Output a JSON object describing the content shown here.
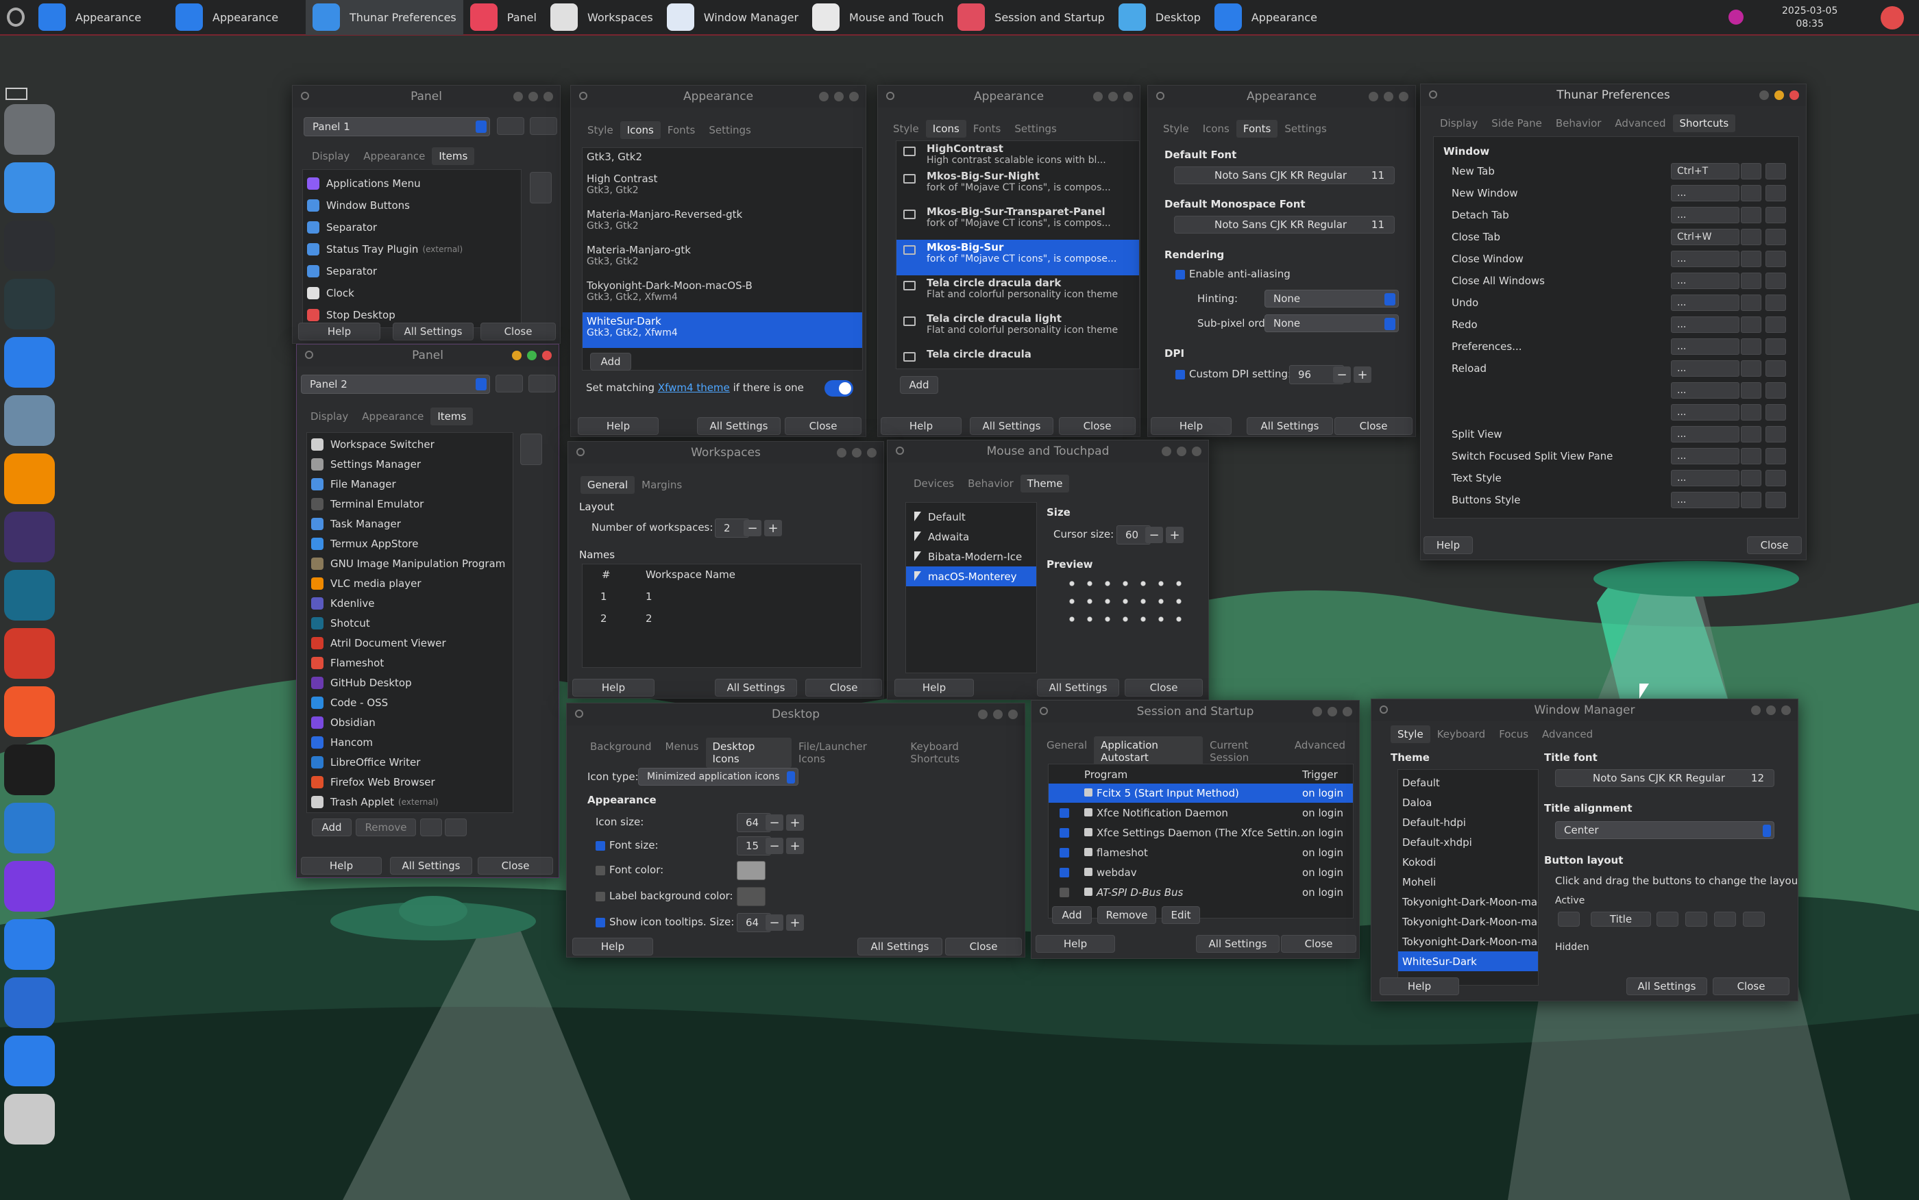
{
  "topbar": {
    "tasks": [
      {
        "label": "Appearance",
        "color": "#2b7de9"
      },
      {
        "label": "Appearance",
        "color": "#2b7de9"
      },
      {
        "label": "Thunar Preferences",
        "color": "#3a8ee6",
        "active": true
      },
      {
        "label": "Panel",
        "color": "#e8445a"
      },
      {
        "label": "Workspaces",
        "color": "#e0e0e0"
      },
      {
        "label": "Window Manager",
        "color": "#dfe8f5"
      },
      {
        "label": "Mouse and Touch",
        "color": "#e8e8e8"
      },
      {
        "label": "Session and Startup",
        "color": "#e04c5e"
      },
      {
        "label": "Desktop",
        "color": "#4aa8e8"
      },
      {
        "label": "Appearance",
        "color": "#2b7de9"
      }
    ],
    "date": "2025-03-05",
    "time": "08:35"
  },
  "dock": {
    "icons": [
      "system-preferences-icon",
      "finder-icon",
      "terminal-icon",
      "activity-monitor-icon",
      "app-store-icon",
      "preview-icon",
      "vlc-icon",
      "kdenlive-icon",
      "shotcut-icon",
      "pdf-viewer-icon",
      "flameshot-icon",
      "github-icon",
      "vscode-icon",
      "obsidian-icon",
      "text-editor-icon",
      "writer-icon",
      "firefox-icon",
      "trash-icon"
    ]
  },
  "panel1": {
    "title": "Panel",
    "selector": "Panel 1",
    "tabs": [
      "Display",
      "Appearance",
      "Items"
    ],
    "items": [
      {
        "label": "Applications Menu",
        "color": "#8c5cf5"
      },
      {
        "label": "Window Buttons",
        "color": "#4a90e2"
      },
      {
        "label": "Separator",
        "color": "#4a90e2"
      },
      {
        "label": "Status Tray Plugin",
        "extra": "(external)",
        "color": "#4a90e2"
      },
      {
        "label": "Separator",
        "color": "#4a90e2"
      },
      {
        "label": "Clock",
        "color": "#e0e0e0"
      },
      {
        "label": "Stop Desktop",
        "color": "#e24b4b"
      }
    ],
    "help": "Help",
    "all": "All Settings",
    "close": "Close"
  },
  "panel2": {
    "title": "Panel",
    "selector": "Panel 2",
    "tabs": [
      "Display",
      "Appearance",
      "Items"
    ],
    "items": [
      {
        "label": "Workspace Switcher",
        "color": "#cfcfcf"
      },
      {
        "label": "Settings Manager",
        "color": "#9a9a9a"
      },
      {
        "label": "File Manager",
        "color": "#4a90e2"
      },
      {
        "label": "Terminal Emulator",
        "color": "#555"
      },
      {
        "label": "Task Manager",
        "color": "#4a90e2"
      },
      {
        "label": "Termux AppStore",
        "color": "#3a8ee6"
      },
      {
        "label": "GNU Image Manipulation Program",
        "color": "#8a7a5a"
      },
      {
        "label": "VLC media player",
        "color": "#f08a00"
      },
      {
        "label": "Kdenlive",
        "color": "#5a5ac0"
      },
      {
        "label": "Shotcut",
        "color": "#1a6a8a"
      },
      {
        "label": "Atril Document Viewer",
        "color": "#d23a2a"
      },
      {
        "label": "Flameshot",
        "color": "#e04c3a"
      },
      {
        "label": "GitHub Desktop",
        "color": "#6a3ab0"
      },
      {
        "label": "Code - OSS",
        "color": "#2a8ae0"
      },
      {
        "label": "Obsidian",
        "color": "#7a4ae0"
      },
      {
        "label": "Hancom",
        "color": "#2a6ae0"
      },
      {
        "label": "LibreOffice Writer",
        "color": "#2a7ad0"
      },
      {
        "label": "Firefox Web Browser",
        "color": "#e0502a"
      },
      {
        "label": "Trash Applet",
        "extra": "(external)",
        "color": "#cfcfcf"
      }
    ],
    "add": "Add",
    "remove": "Remove",
    "help": "Help",
    "all": "All Settings",
    "close": "Close"
  },
  "appearance_style": {
    "title": "Appearance",
    "tabs": [
      "Style",
      "Icons",
      "Fonts",
      "Settings"
    ],
    "themes": [
      {
        "name": "Gtk3, Gtk2",
        "sub": ""
      },
      {
        "name": "High Contrast",
        "sub": "Gtk3, Gtk2"
      },
      {
        "name": "Materia-Manjaro-Reversed-gtk",
        "sub": "Gtk3, Gtk2"
      },
      {
        "name": "Materia-Manjaro-gtk",
        "sub": "Gtk3, Gtk2"
      },
      {
        "name": "Tokyonight-Dark-Moon-macOS-B",
        "sub": "Gtk3, Gtk2, Xfwm4"
      },
      {
        "name": "WhiteSur-Dark",
        "sub": "Gtk3, Gtk2, Xfwm4",
        "selected": true
      }
    ],
    "add": "Add",
    "matching_pre": "Set matching",
    "matching_link": "Xfwm4 theme",
    "matching_post": "if there is one",
    "help": "Help",
    "all": "All Settings",
    "close": "Close"
  },
  "appearance_icons": {
    "title": "Appearance",
    "tabs": [
      "Style",
      "Icons",
      "Fonts",
      "Settings"
    ],
    "icons": [
      {
        "name": "HighContrast",
        "sub": "High contrast scalable icons with bl..."
      },
      {
        "name": "Mkos-Big-Sur-Night",
        "sub": "fork of \"Mojave CT icons\", is compos..."
      },
      {
        "name": "Mkos-Big-Sur-Transparet-Panel",
        "sub": "fork of \"Mojave CT icons\", is compos..."
      },
      {
        "name": "Mkos-Big-Sur",
        "sub": "fork of \"Mojave CT icons\", is compose...",
        "selected": true
      },
      {
        "name": "Tela circle dracula dark",
        "sub": "Flat and colorful personality icon theme"
      },
      {
        "name": "Tela circle dracula light",
        "sub": "Flat and colorful personality icon theme"
      },
      {
        "name": "Tela circle dracula",
        "sub": ""
      }
    ],
    "add": "Add",
    "help": "Help",
    "all": "All Settings",
    "close": "Close"
  },
  "appearance_fonts": {
    "title": "Appearance",
    "tabs": [
      "Style",
      "Icons",
      "Fonts",
      "Settings"
    ],
    "default_font_label": "Default Font",
    "default_font": "Noto Sans CJK KR Regular",
    "default_size": "11",
    "mono_label": "Default Monospace Font",
    "mono_font": "Noto Sans CJK KR Regular",
    "mono_size": "11",
    "rendering": "Rendering",
    "antialias": "Enable anti-aliasing",
    "hinting_label": "Hinting:",
    "hinting": "None",
    "subpixel_label": "Sub-pixel order:",
    "subpixel": "None",
    "dpi": "DPI",
    "custom_dpi": "Custom DPI setting:",
    "dpi_value": "96",
    "help": "Help",
    "all": "All Settings",
    "close": "Close"
  },
  "thunar": {
    "title": "Thunar Preferences",
    "tabs": [
      "Display",
      "Side Pane",
      "Behavior",
      "Advanced",
      "Shortcuts"
    ],
    "section": "Window",
    "shortcuts": [
      {
        "label": "New Tab",
        "key": "Ctrl+T"
      },
      {
        "label": "New Window",
        "key": "..."
      },
      {
        "label": "Detach Tab",
        "key": "..."
      },
      {
        "label": "Close Tab",
        "key": "Ctrl+W"
      },
      {
        "label": "Close Window",
        "key": "..."
      },
      {
        "label": "Close All Windows",
        "key": "..."
      },
      {
        "label": "Undo",
        "key": "..."
      },
      {
        "label": "Redo",
        "key": "..."
      },
      {
        "label": "Preferences...",
        "key": "..."
      },
      {
        "label": "Reload",
        "key": "..."
      },
      {
        "label": "",
        "key": "..."
      },
      {
        "label": "",
        "key": "..."
      },
      {
        "label": "Split View",
        "key": "..."
      },
      {
        "label": "Switch Focused Split View Pane",
        "key": "..."
      },
      {
        "label": "Text Style",
        "key": "..."
      },
      {
        "label": "Buttons Style",
        "key": "..."
      }
    ],
    "help": "Help",
    "close": "Close"
  },
  "workspaces": {
    "title": "Workspaces",
    "tabs": [
      "General",
      "Margins"
    ],
    "layout": "Layout",
    "num_label": "Number of workspaces:",
    "num": "2",
    "names": "Names",
    "col_num": "#",
    "col_name": "Workspace Name",
    "rows": [
      {
        "n": "1",
        "name": "1"
      },
      {
        "n": "2",
        "name": "2"
      }
    ],
    "help": "Help",
    "all": "All Settings",
    "close": "Close"
  },
  "mouse": {
    "title": "Mouse and Touchpad",
    "tabs": [
      "Devices",
      "Behavior",
      "Theme"
    ],
    "themes": [
      {
        "name": "Default"
      },
      {
        "name": "Adwaita"
      },
      {
        "name": "Bibata-Modern-Ice"
      },
      {
        "name": "macOS-Monterey",
        "selected": true
      }
    ],
    "size": "Size",
    "cursor_label": "Cursor size:",
    "cursor_size": "60",
    "preview": "Preview",
    "help": "Help",
    "all": "All Settings",
    "close": "Close"
  },
  "desktop": {
    "title": "Desktop",
    "tabs": [
      "Background",
      "Menus",
      "Desktop Icons",
      "File/Launcher Icons",
      "Keyboard Shortcuts"
    ],
    "icon_type_label": "Icon type:",
    "icon_type": "Minimized application icons",
    "appearance": "Appearance",
    "icon_size_label": "Icon size:",
    "icon_size": "64",
    "font_size_label": "Font size:",
    "font_size": "15",
    "font_color_label": "Font color:",
    "label_bg_label": "Label background color:",
    "tooltips_label": "Show icon tooltips. Size:",
    "tooltip_size": "64",
    "help": "Help",
    "all": "All Settings",
    "close": "Close"
  },
  "session": {
    "title": "Session and Startup",
    "tabs": [
      "General",
      "Application Autostart",
      "Current Session",
      "Advanced"
    ],
    "col_program": "Program",
    "col_trigger": "Trigger",
    "rows": [
      {
        "name": "Fcitx 5 (Start Input Method)",
        "trigger": "on login",
        "checked": true,
        "selected": true
      },
      {
        "name": "Xfce Notification Daemon",
        "trigger": "on login",
        "checked": true
      },
      {
        "name": "Xfce Settings Daemon (The Xfce Settin...",
        "trigger": "on login",
        "checked": true
      },
      {
        "name": "flameshot",
        "trigger": "on login",
        "checked": true
      },
      {
        "name": "webdav",
        "trigger": "on login",
        "checked": true
      },
      {
        "name": "AT-SPI D-Bus Bus",
        "trigger": "on login",
        "checked": false
      }
    ],
    "add": "Add",
    "remove": "Remove",
    "edit": "Edit",
    "help": "Help",
    "all": "All Settings",
    "close": "Close"
  },
  "wm": {
    "title": "Window Manager",
    "tabs": [
      "Style",
      "Keyboard",
      "Focus",
      "Advanced"
    ],
    "theme_label": "Theme",
    "themes": [
      {
        "name": "Default"
      },
      {
        "name": "Daloa"
      },
      {
        "name": "Default-hdpi"
      },
      {
        "name": "Default-xhdpi"
      },
      {
        "name": "Kokodi"
      },
      {
        "name": "Moheli"
      },
      {
        "name": "Tokyonight-Dark-Moon-macOS"
      },
      {
        "name": "Tokyonight-Dark-Moon-macOS"
      },
      {
        "name": "Tokyonight-Dark-Moon-macOS"
      },
      {
        "name": "WhiteSur-Dark",
        "selected": true
      }
    ],
    "title_font_label": "Title font",
    "title_font": "Noto Sans CJK KR Regular",
    "title_font_size": "12",
    "align_label": "Title alignment",
    "align": "Center",
    "layout_label": "Button layout",
    "layout_hint": "Click and drag the buttons to change the layout",
    "active": "Active",
    "title_btn": "Title",
    "hidden": "Hidden",
    "help": "Help",
    "all": "All Settings",
    "close": "Close"
  }
}
